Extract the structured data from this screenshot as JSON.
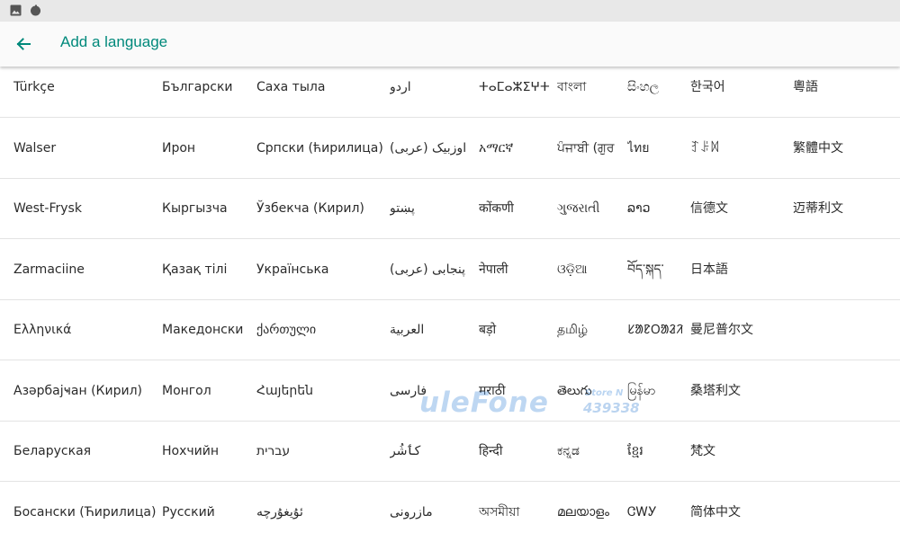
{
  "app_bar": {
    "title": "Add a language"
  },
  "watermark": {
    "brand": "uleFone",
    "store": "Store N",
    "number": "439338"
  },
  "language_rows": [
    [
      "Türkçe",
      "Български",
      "Саха тыла",
      "اردو",
      "ⵜⴰⵎⴰⵣⵉⵖⵜ",
      "বাংলা",
      "සිංහල",
      "한국어",
      "粵語"
    ],
    [
      "Walser",
      "Ирон",
      "Српски (ћирилица)",
      "اوزبیک (عربی)",
      "አማርኛ",
      "ਪੰਜਾਬੀ (ਗੁਰ",
      "ไทย",
      "ꆈꌠꉙ",
      "繁體中文"
    ],
    [
      "West-Frysk",
      "Кыргызча",
      "Ўзбекча (Кирил)",
      "پښتو",
      "कोंकणी",
      "ગુજરાતી",
      "ລາວ",
      "信德文",
      "迈蒂利文"
    ],
    [
      "Zarmaciine",
      "Қазақ тілі",
      "Українська",
      "پنجابی (عربی)",
      "नेपाली",
      "ଓଡ଼ିଆ",
      "བོད་སྐད་",
      "日本語",
      ""
    ],
    [
      "Ελληνικά",
      "Македонски",
      "ქართული",
      "العربية",
      "बड़ो",
      "தமிழ்",
      "ᱥᱟᱱᱛᱟᱲᱤ",
      "曼尼普尔文",
      ""
    ],
    [
      "Азәрбајҹан (Кирил)",
      "Монгол",
      "Հայերեն",
      "فارسی",
      "मराठी",
      "తెలుగు",
      "မြန်မာ",
      "桑塔利文",
      ""
    ],
    [
      "Беларуская",
      "Нохчийн",
      "עברית",
      "کٲشُر",
      "हिन्दी",
      "ಕನ್ನಡ",
      "ខ្មែរ",
      "梵文",
      ""
    ],
    [
      "Босански (Ћирилица)",
      "Русский",
      "ئۇيغۇرچە",
      "مازرونی",
      "অসমীয়া",
      "മലയാളം",
      "ᏣᎳᎩ",
      "简体中文",
      ""
    ]
  ]
}
